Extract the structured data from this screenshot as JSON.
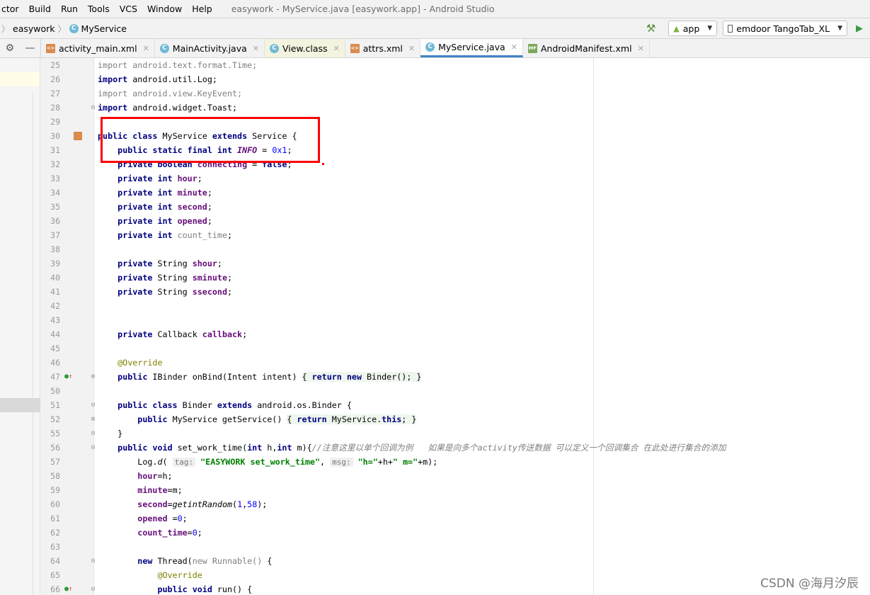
{
  "menu": {
    "items": [
      "ctor",
      "Build",
      "Run",
      "Tools",
      "VCS",
      "Window",
      "Help"
    ],
    "window_title": "easywork - MyService.java [easywork.app] - Android Studio"
  },
  "breadcrumb": {
    "project": "easywork",
    "file": "MyService"
  },
  "toolbar": {
    "config": "app",
    "device": "emdoor TangoTab_XL"
  },
  "tabs": [
    {
      "label": "activity_main.xml",
      "icon": "xml-icon"
    },
    {
      "label": "MainActivity.java",
      "icon": "class-icon"
    },
    {
      "label": "View.class",
      "icon": "class-icon"
    },
    {
      "label": "attrs.xml",
      "icon": "xml-icon"
    },
    {
      "label": "MyService.java",
      "icon": "class-icon",
      "active": true
    },
    {
      "label": "AndroidManifest.xml",
      "icon": "manifest-icon"
    }
  ],
  "code_lines": [
    {
      "n": "25",
      "t": "import android.text.format.Time;"
    },
    {
      "n": "26",
      "t": "import android.util.Log;"
    },
    {
      "n": "27",
      "t": "import android.view.KeyEvent;"
    },
    {
      "n": "28",
      "t": "import android.widget.Toast;"
    },
    {
      "n": "29",
      "t": ""
    },
    {
      "n": "30",
      "t": "public class MyService extends Service {"
    },
    {
      "n": "31",
      "t": "    public static final int INFO = 0x1;"
    },
    {
      "n": "32",
      "t": "    private boolean connecting = false;"
    },
    {
      "n": "33",
      "t": "    private int hour;"
    },
    {
      "n": "34",
      "t": "    private int minute;"
    },
    {
      "n": "35",
      "t": "    private int second;"
    },
    {
      "n": "36",
      "t": "    private int opened;"
    },
    {
      "n": "37",
      "t": "    private int count_time;"
    },
    {
      "n": "38",
      "t": ""
    },
    {
      "n": "39",
      "t": "    private String shour;"
    },
    {
      "n": "40",
      "t": "    private String sminute;"
    },
    {
      "n": "41",
      "t": "    private String ssecond;"
    },
    {
      "n": "42",
      "t": ""
    },
    {
      "n": "43",
      "t": ""
    },
    {
      "n": "44",
      "t": "    private Callback callback;"
    },
    {
      "n": "45",
      "t": ""
    },
    {
      "n": "46",
      "t": "    @Override"
    },
    {
      "n": "47",
      "t": "    public IBinder onBind(Intent intent) { return new Binder(); }"
    },
    {
      "n": "50",
      "t": ""
    },
    {
      "n": "51",
      "t": "    public class Binder extends android.os.Binder {"
    },
    {
      "n": "52",
      "t": "        public MyService getService() { return MyService.this; }"
    },
    {
      "n": "55",
      "t": "    }"
    },
    {
      "n": "56",
      "t": "    public void set_work_time(int h,int m){//注意这里以单个回调为例   如果是向多个activity传送数据 可以定义一个回调集合 在此处进行集合的添加"
    },
    {
      "n": "57",
      "t": "        Log.d( tag: \"EASYWORK set_work_time\", msg: \"h=\"+h+\" m=\"+m);"
    },
    {
      "n": "58",
      "t": "        hour=h;"
    },
    {
      "n": "59",
      "t": "        minute=m;"
    },
    {
      "n": "60",
      "t": "        second=getintRandom(1,58);"
    },
    {
      "n": "61",
      "t": "        opened =0;"
    },
    {
      "n": "62",
      "t": "        count_time=0;"
    },
    {
      "n": "63",
      "t": ""
    },
    {
      "n": "64",
      "t": "        new Thread(new Runnable() {"
    },
    {
      "n": "65",
      "t": "            @Override"
    },
    {
      "n": "66",
      "t": "            public void run() {"
    }
  ],
  "colors": {
    "highlight_box": "#ff0000",
    "keyword": "#000080",
    "field": "#660e7a",
    "string": "#008000",
    "number": "#0000ff",
    "comment": "#808080"
  },
  "watermark": "CSDN @海月汐辰"
}
